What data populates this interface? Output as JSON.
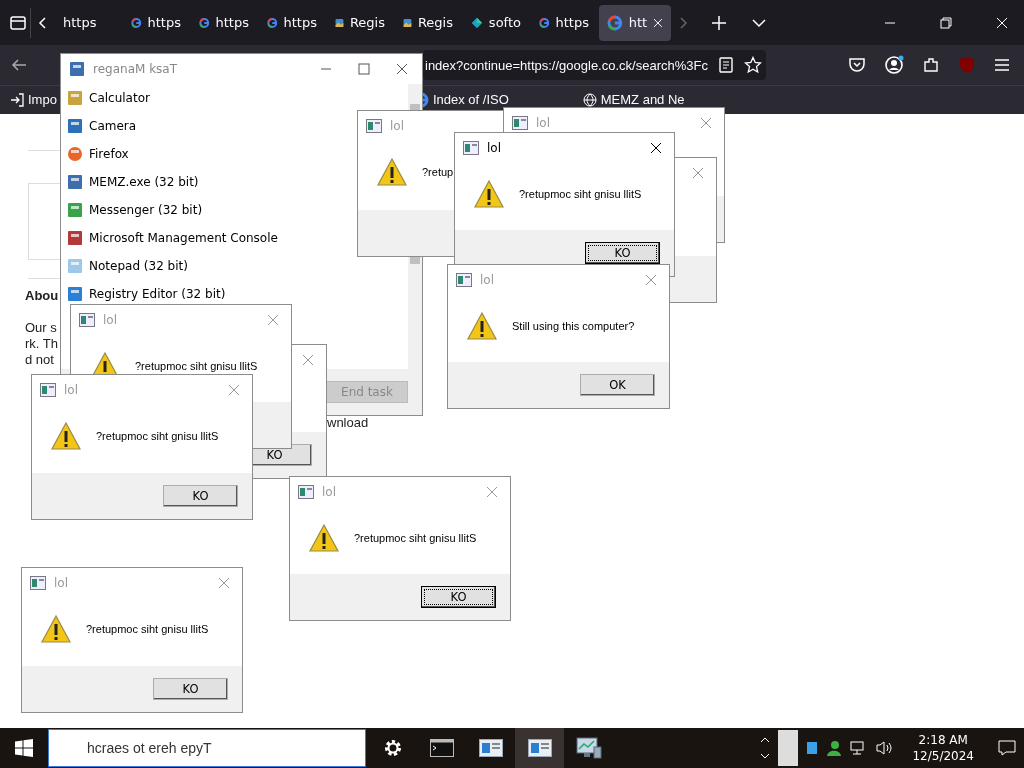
{
  "browser": {
    "tabs": [
      {
        "label": "https",
        "selected": false
      },
      {
        "label": "https",
        "selected": false
      },
      {
        "label": "https",
        "selected": false
      },
      {
        "label": "https",
        "selected": false
      },
      {
        "label": "Regis",
        "selected": false
      },
      {
        "label": "Regis",
        "selected": false
      },
      {
        "label": "softo",
        "selected": false
      },
      {
        "label": "https",
        "selected": false
      },
      {
        "label": "htt",
        "selected": true
      }
    ],
    "address": "index?continue=https://google.co.ck/search%3Fc",
    "bookmarks": [
      "Impo",
      "Index of /ISO",
      "MEMZ and Ne"
    ]
  },
  "page": {
    "heading": "Abou",
    "lines": [
      "Our s",
      "rk. Th",
      "d not"
    ],
    "fragment": "wnload"
  },
  "task_manager": {
    "title": "reganaM ksaT",
    "items": [
      "Calculator",
      "Camera",
      "Firefox",
      "MEMZ.exe (32 bit)",
      "Messenger (32 bit)",
      "Microsoft Management Console",
      "Notepad (32 bit)",
      "Registry Editor (32 bit)"
    ],
    "end_task": {
      "label": "End task",
      "disabled": true
    }
  },
  "dialogs": [
    {
      "title": "lol",
      "message": "?retup",
      "active": false
    },
    {
      "title": "lol",
      "active": false
    },
    {
      "active": false
    },
    {
      "title": "lol",
      "message": "?retupmoc siht gnisu llitS",
      "button": "KO",
      "focused": true,
      "active": true
    },
    {
      "title": "lol",
      "message": "Still using this computer?",
      "button": "OK",
      "focused": false,
      "active": false
    },
    {
      "button": "KO",
      "focused": false,
      "active": false
    },
    {
      "title": "lol",
      "message": "?retupmoc siht gnisu llitS",
      "active": false
    },
    {
      "title": "lol",
      "message": "?retupmoc siht gnisu llitS",
      "button": "KO",
      "focused": false,
      "active": false
    },
    {
      "title": "lol",
      "message": "?retupmoc siht gnisu llitS",
      "button": "KO",
      "focused": true,
      "active": false
    },
    {
      "title": "lol",
      "message": "?retupmoc siht gnisu llitS",
      "button": "KO",
      "focused": false,
      "active": false
    }
  ],
  "taskbar": {
    "search": "hcraes ot ereh epyT",
    "apps": [
      {
        "selected": false
      },
      {
        "selected": false
      },
      {
        "selected": false
      },
      {
        "selected": true
      },
      {
        "selected": false
      }
    ],
    "time": "2:18 AM",
    "date": "12/5/2024"
  }
}
